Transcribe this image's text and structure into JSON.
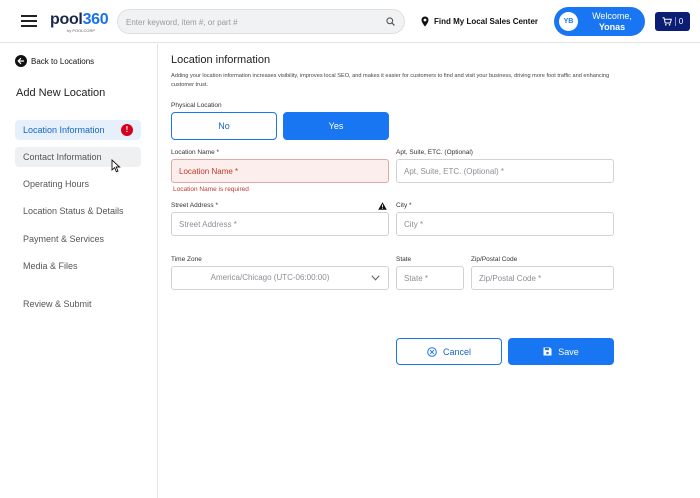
{
  "header": {
    "logo_text_a": "pool",
    "logo_text_b": "360",
    "logo_sub": "by POOLCORP",
    "search_placeholder": "Enter keyword, item #, or part #",
    "locator_label": "Find My Local Sales Center",
    "avatar_initials": "YB",
    "welcome_line1": "Welcome,",
    "welcome_line2": "Yonas",
    "cart_count": "0"
  },
  "sidebar": {
    "back_label": "Back to Locations",
    "title": "Add New Location",
    "items": [
      {
        "label": "Location Information",
        "state": "active",
        "alert": "!"
      },
      {
        "label": "Contact Information",
        "state": "hover"
      },
      {
        "label": "Operating Hours"
      },
      {
        "label": "Location Status & Details"
      },
      {
        "label": "Payment & Services"
      },
      {
        "label": "Media & Files"
      },
      {
        "label": "Review & Submit"
      }
    ]
  },
  "main": {
    "title": "Location information",
    "description": "Adding your location information increases visibility, improves local SEO, and makes it easier for customers to find and visit your business, driving more foot traffic and enhancing customer trust.",
    "physical_location_label": "Physical Location",
    "toggle_no": "No",
    "toggle_yes": "Yes",
    "location_name_label": "Location Name *",
    "location_name_placeholder": "Location Name *",
    "location_name_error": "Location Name is required",
    "apt_label": "Apt, Suite, ETC. (Optional)",
    "apt_placeholder": "Apt, Suite, ETC. (Optional) *",
    "street_label": "Street Address *",
    "street_placeholder": "Street Address *",
    "city_label": "City *",
    "city_placeholder": "City *",
    "timezone_label": "Time Zone",
    "timezone_value": "America/Chicago (UTC-06:00:00)",
    "state_label": "State",
    "state_placeholder": "State *",
    "zip_label": "Zip/Postal Code",
    "zip_placeholder": "Zip/Postal Code *",
    "cancel_label": "Cancel",
    "save_label": "Save"
  },
  "colors": {
    "accent": "#1976f2",
    "navy": "#0b1e74",
    "error": "#c0392b",
    "active_bg": "#e6f0fb"
  }
}
